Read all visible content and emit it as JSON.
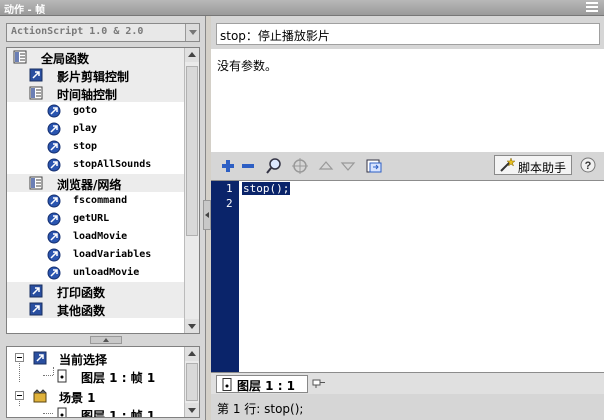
{
  "window": {
    "title": "动作 - 帧"
  },
  "toolbox": {
    "version_select": "ActionScript 1.0 & 2.0",
    "items": [
      {
        "label": "全局函数",
        "type": "category"
      },
      {
        "label": "影片剪辑控制",
        "type": "category"
      },
      {
        "label": "时间轴控制",
        "type": "category"
      },
      {
        "label": "goto",
        "type": "function"
      },
      {
        "label": "play",
        "type": "function"
      },
      {
        "label": "stop",
        "type": "function"
      },
      {
        "label": "stopAllSounds",
        "type": "function"
      },
      {
        "label": "浏览器/网络",
        "type": "category"
      },
      {
        "label": "fscommand",
        "type": "function"
      },
      {
        "label": "getURL",
        "type": "function"
      },
      {
        "label": "loadMovie",
        "type": "function"
      },
      {
        "label": "loadVariables",
        "type": "function"
      },
      {
        "label": "unloadMovie",
        "type": "function"
      },
      {
        "label": "打印函数",
        "type": "category"
      },
      {
        "label": "其他函数",
        "type": "category"
      }
    ]
  },
  "script_navigator": {
    "items": [
      {
        "label": "当前选择"
      },
      {
        "label": "图层 1 : 帧 1"
      },
      {
        "label": "场景 1"
      },
      {
        "label": "图层 1 : 帧 1"
      }
    ]
  },
  "help": {
    "title": "stop：停止播放影片",
    "description": "没有参数。"
  },
  "toolbar": {
    "buttons": [
      "add-icon",
      "remove-icon",
      "find-icon",
      "target-icon",
      "up-arrow-icon",
      "down-arrow-icon",
      "outline-icon"
    ],
    "script_assist_label": "脚本助手"
  },
  "editor": {
    "lines": [
      {
        "number": "1",
        "code": "stop();"
      },
      {
        "number": "2",
        "code": ""
      }
    ],
    "selection_color": "#0a246a"
  },
  "frame_tab": {
    "label": "图层 1 : 1"
  },
  "status_bar": {
    "text": "第 1 行: stop();"
  }
}
